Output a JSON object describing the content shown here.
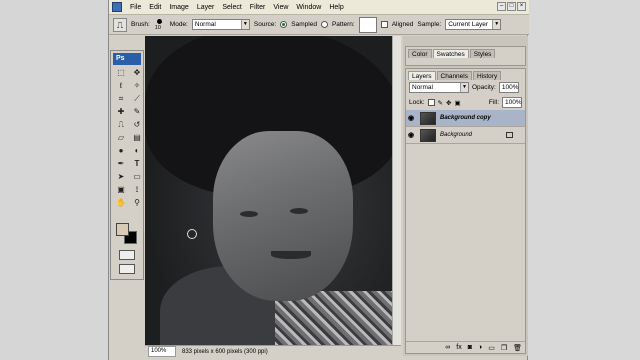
{
  "menu": {
    "items": [
      "File",
      "Edit",
      "Image",
      "Layer",
      "Select",
      "Filter",
      "View",
      "Window",
      "Help"
    ]
  },
  "options": {
    "brush_label": "Brush:",
    "brush_size": "10",
    "mode_label": "Mode:",
    "mode_value": "Normal",
    "source_label": "Source:",
    "sampled_label": "Sampled",
    "pattern_label": "Pattern:",
    "aligned_label": "Aligned",
    "sample_label": "Sample:",
    "sample_value": "Current Layer"
  },
  "toolbox": {
    "logo": "Ps",
    "tools": [
      "marquee-icon",
      "move-icon",
      "lasso-icon",
      "magic-wand-icon",
      "crop-icon",
      "slice-icon",
      "healing-icon",
      "brush-icon",
      "clone-stamp-icon",
      "history-brush-icon",
      "eraser-icon",
      "gradient-icon",
      "blur-icon",
      "dodge-icon",
      "pen-icon",
      "type-icon",
      "path-select-icon",
      "shape-icon",
      "notes-icon",
      "eyedropper-icon",
      "hand-icon",
      "zoom-icon"
    ]
  },
  "colors": {
    "foreground": "#d8cbb6",
    "background": "#000000"
  },
  "status": {
    "zoom": "100%",
    "doc_info": "833 pixels x 600 pixels (300 ppi)"
  },
  "palette_top": {
    "tabs": [
      "Color",
      "Swatches",
      "Styles"
    ]
  },
  "layers_panel": {
    "tabs": [
      "Layers",
      "Channels",
      "History"
    ],
    "blend_mode": "Normal",
    "opacity_label": "Opacity:",
    "opacity_value": "100%",
    "lock_label": "Lock:",
    "fill_label": "Fill:",
    "fill_value": "100%",
    "layers": [
      {
        "name": "Background copy",
        "selected": true
      },
      {
        "name": "Background",
        "selected": false
      }
    ]
  }
}
